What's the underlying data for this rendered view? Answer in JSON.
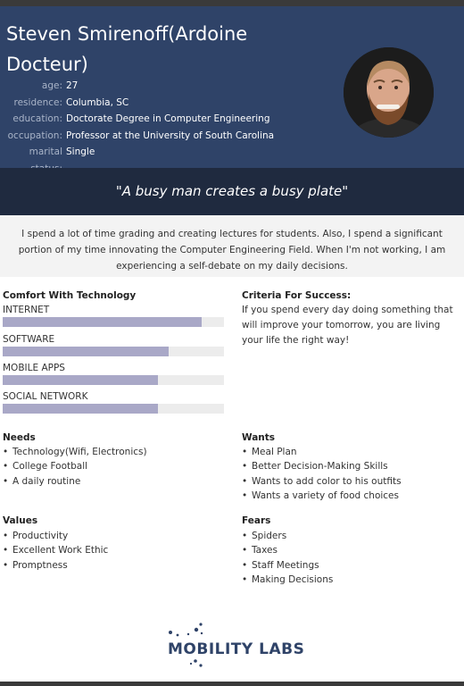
{
  "header": {
    "name": "Steven Smirenoff(Ardoine Docteur)",
    "info": [
      {
        "label": "age:",
        "value": "27"
      },
      {
        "label": "residence:",
        "value": "Columbia, SC"
      },
      {
        "label": "education:",
        "value": "Doctorate Degree in Computer Engineering"
      },
      {
        "label": "occupation:",
        "value": "Professor at the University of South Carolina"
      },
      {
        "label": "marital status:",
        "value": "Single"
      }
    ]
  },
  "quote": "\"A busy man creates a busy plate\"",
  "bio": "I spend a lot of time grading and creating lectures for students. Also, I spend a significant portion of my time innovating the Computer Engineering Field. When I'm not working, I am experiencing a self-debate on my daily decisions.",
  "tech": {
    "title": "Comfort With Technology",
    "items": [
      {
        "label": "INTERNET",
        "level": 0.9
      },
      {
        "label": "SOFTWARE",
        "level": 0.75
      },
      {
        "label": "MOBILE APPS",
        "level": 0.7
      },
      {
        "label": "SOCIAL NETWORK",
        "level": 0.7
      }
    ]
  },
  "criteria": {
    "title": "Criteria For Success:",
    "text": "If you spend every day doing something that will improve your tomorrow, you are living your life the right way!"
  },
  "needs": {
    "title": "Needs",
    "items": [
      "Technology(Wifi, Electronics)",
      "College Football",
      "A daily routine"
    ]
  },
  "wants": {
    "title": "Wants",
    "items": [
      "Meal Plan",
      "Better Decision-Making Skills",
      "Wants to add color to his outfits",
      "Wants a variety of food choices"
    ]
  },
  "values": {
    "title": "Values",
    "items": [
      "Productivity",
      "Excellent Work Ethic",
      "Promptness"
    ]
  },
  "fears": {
    "title": "Fears",
    "items": [
      "Spiders",
      "Taxes",
      "Staff Meetings",
      "Making Decisions"
    ]
  },
  "logo": {
    "text": "MOBILITY LABS",
    "color": "#2f4368"
  },
  "colors": {
    "header": "#2f4368",
    "quote_bar": "#1f2a3f",
    "bar_fill": "#a9a8c7",
    "bar_track": "#ececec"
  }
}
